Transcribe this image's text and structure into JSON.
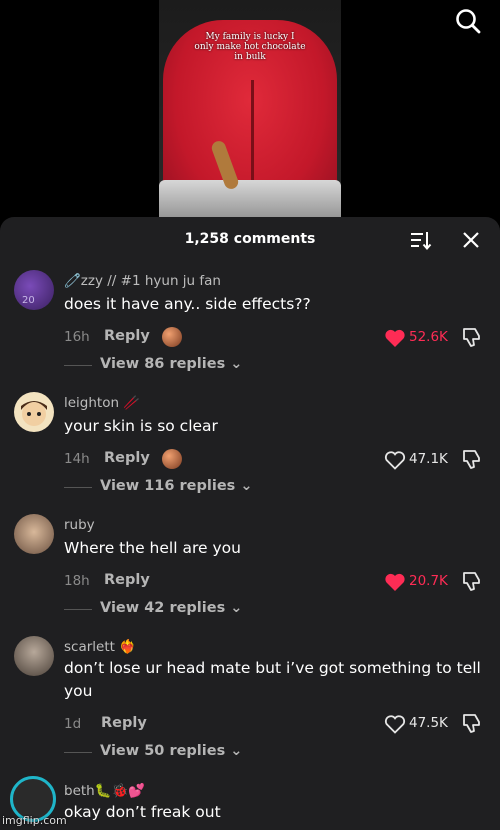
{
  "video": {
    "caption_line1": "My family is lucky I",
    "caption_line2": "only make hot chocolate",
    "caption_line3": "in bulk"
  },
  "header": {
    "comment_count": "1,258 comments"
  },
  "colors": {
    "liked_red": "#fe2c55",
    "sheet_bg": "#1f1f21"
  },
  "comments": [
    {
      "username": "🧷zzy // #1 hyun ju fan",
      "text": "does it have any.. side effects??",
      "time": "16h",
      "reply_label": "Reply",
      "likes": "52.6K",
      "liked": true,
      "view_replies": "View 86 replies"
    },
    {
      "username": "leighton 🥢",
      "text": "your skin is so clear",
      "time": "14h",
      "reply_label": "Reply",
      "likes": "47.1K",
      "liked": false,
      "view_replies": "View 116 replies"
    },
    {
      "username": "ruby",
      "text": "Where the hell are you",
      "time": "18h",
      "reply_label": "Reply",
      "likes": "20.7K",
      "liked": true,
      "view_replies": "View 42 replies"
    },
    {
      "username": "scarlett ❤️‍🔥",
      "text": "don’t lose ur head mate but i’ve got something to tell you",
      "time": "1d",
      "reply_label": "Reply",
      "likes": "47.5K",
      "liked": false,
      "view_replies": "View 50 replies"
    },
    {
      "username": "beth🐛🐞💕",
      "text": "okay don’t freak out"
    }
  ],
  "watermark": "imgflip.com"
}
